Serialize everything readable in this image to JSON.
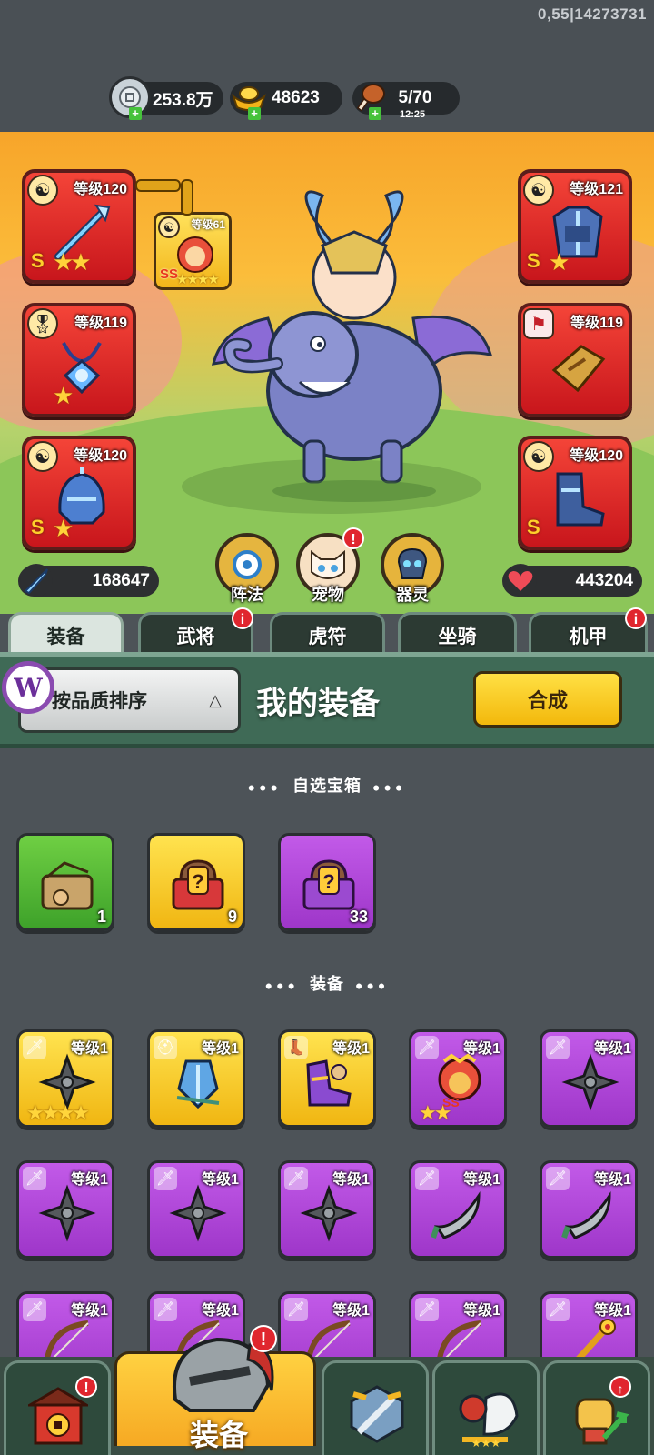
{
  "status": {
    "build_info": "0,55|14273731"
  },
  "resources": {
    "silver": {
      "value": "253.8万",
      "icon": "silver-coin-icon"
    },
    "gold": {
      "value": "48623",
      "icon": "gold-ingot-icon"
    },
    "stamina": {
      "value": "5/70",
      "timer": "12:25",
      "icon": "meat-drumstick-icon"
    }
  },
  "hero": {
    "left_slots": [
      {
        "level": "等级120",
        "grade": "S",
        "stars": "★★",
        "type_icon": "yin-yang-icon",
        "item": "ice-spear"
      },
      {
        "level": "等级119",
        "grade": "",
        "stars": "★",
        "type_icon": "medal-icon",
        "item": "amulet"
      },
      {
        "level": "等级120",
        "grade": "S",
        "stars": "★",
        "type_icon": "yin-yang-icon",
        "item": "ice-helmet"
      }
    ],
    "right_slots": [
      {
        "level": "等级121",
        "grade": "S",
        "stars": "★",
        "type_icon": "yin-yang-icon",
        "item": "ice-armor"
      },
      {
        "level": "等级119",
        "grade": "",
        "stars": "",
        "type_icon": "tiger-tally-icon",
        "item": "tally"
      },
      {
        "level": "等级120",
        "grade": "S",
        "stars": "",
        "type_icon": "yin-yang-icon",
        "item": "ice-boots"
      }
    ],
    "pet_slot": {
      "level": "等级61",
      "grade": "SS",
      "stars": "★★★★"
    },
    "attack": "168647",
    "hp": "443204",
    "buttons": [
      {
        "label": "阵法",
        "icon": "formation-compass-icon",
        "badge": ""
      },
      {
        "label": "宠物",
        "icon": "cat-pet-icon",
        "badge": "!"
      },
      {
        "label": "器灵",
        "icon": "spirit-icon",
        "badge": ""
      }
    ]
  },
  "tabs": [
    {
      "label": "装备",
      "active": true,
      "badge": ""
    },
    {
      "label": "武将",
      "active": false,
      "badge": "i"
    },
    {
      "label": "虎符",
      "active": false,
      "badge": ""
    },
    {
      "label": "坐骑",
      "active": false,
      "badge": ""
    },
    {
      "label": "机甲",
      "active": false,
      "badge": "i"
    }
  ],
  "panel": {
    "sort_label": "按品质排序",
    "sort_arrow": "△",
    "title": "我的装备",
    "synth_label": "合成",
    "logo_letter": "W"
  },
  "sections": {
    "chests_title": "自选宝箱",
    "equipment_title": "装备"
  },
  "chests": [
    {
      "rarity": "green",
      "count": "1",
      "icon": "supply-chest-icon"
    },
    {
      "rarity": "gold",
      "count": "9",
      "icon": "mystery-chest-icon"
    },
    {
      "rarity": "purple",
      "count": "33",
      "icon": "mystery-chest-icon"
    }
  ],
  "equipment": [
    {
      "rarity": "gold",
      "level": "等级1",
      "stars": "★★★★",
      "type": "sword",
      "icon": "shuriken-icon"
    },
    {
      "rarity": "gold",
      "level": "等级1",
      "stars": "",
      "type": "helmet",
      "icon": "blue-armor-icon"
    },
    {
      "rarity": "gold",
      "level": "等级1",
      "stars": "",
      "type": "boot",
      "icon": "purple-boots-icon"
    },
    {
      "rarity": "purple",
      "level": "等级1",
      "stars": "★★",
      "type": "sword",
      "icon": "lion-helm-icon"
    },
    {
      "rarity": "purple",
      "level": "等级1",
      "stars": "",
      "type": "sword",
      "icon": "shuriken-icon"
    },
    {
      "rarity": "purple",
      "level": "等级1",
      "stars": "",
      "type": "sword",
      "icon": "shuriken-icon"
    },
    {
      "rarity": "purple",
      "level": "等级1",
      "stars": "",
      "type": "sword",
      "icon": "shuriken-icon"
    },
    {
      "rarity": "purple",
      "level": "等级1",
      "stars": "",
      "type": "sword",
      "icon": "shuriken-icon"
    },
    {
      "rarity": "purple",
      "level": "等级1",
      "stars": "",
      "type": "sword",
      "icon": "scimitar-icon"
    },
    {
      "rarity": "purple",
      "level": "等级1",
      "stars": "",
      "type": "sword",
      "icon": "scimitar-icon"
    },
    {
      "rarity": "purple",
      "level": "等级1",
      "stars": "",
      "type": "sword",
      "icon": "bow-icon"
    },
    {
      "rarity": "purple",
      "level": "等级1",
      "stars": "",
      "type": "sword",
      "icon": "bow-icon"
    },
    {
      "rarity": "purple",
      "level": "等级1",
      "stars": "",
      "type": "sword",
      "icon": "bow-icon"
    },
    {
      "rarity": "purple",
      "level": "等级1",
      "stars": "",
      "type": "sword",
      "icon": "bow-icon"
    },
    {
      "rarity": "purple",
      "level": "等级1",
      "stars": "",
      "type": "sword",
      "icon": "golden-staff-icon"
    }
  ],
  "bottom_nav": [
    {
      "label": "",
      "icon": "shop-gate-icon",
      "badge": "!",
      "active": false
    },
    {
      "label": "装备",
      "icon": "helmet-icon",
      "badge": "!",
      "active": true
    },
    {
      "label": "",
      "icon": "battle-swords-icon",
      "badge": "",
      "active": false
    },
    {
      "label": "",
      "icon": "rooster-cup-icon",
      "badge": "",
      "active": false
    },
    {
      "label": "",
      "icon": "power-fist-icon",
      "badge": "↑",
      "active": false
    }
  ]
}
